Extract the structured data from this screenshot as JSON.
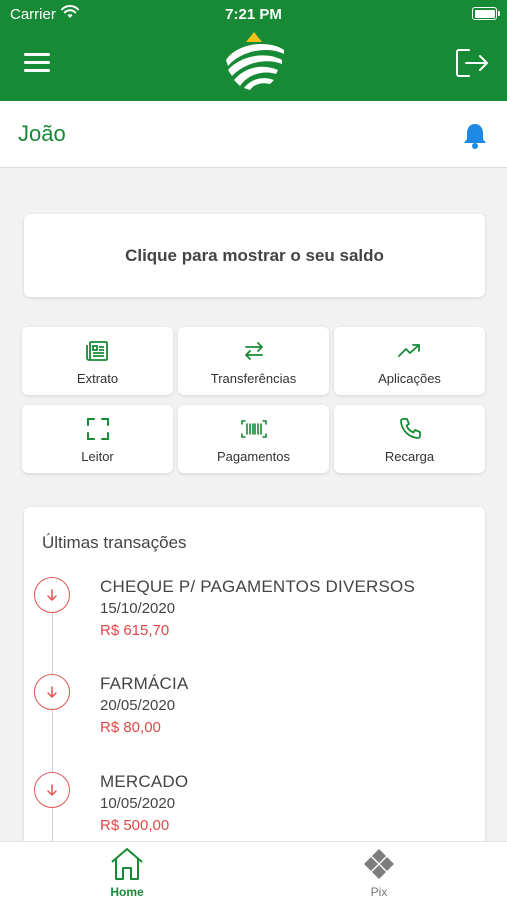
{
  "status_bar": {
    "carrier": "Carrier",
    "time": "7:21 PM"
  },
  "header": {
    "menu_icon": "hamburger-menu-icon",
    "logo": "bank-logo",
    "logout_icon": "logout-icon"
  },
  "user": {
    "name": "João",
    "notification_icon": "bell-icon"
  },
  "balance": {
    "label": "Clique para mostrar o seu saldo"
  },
  "actions": [
    {
      "label": "Extrato",
      "icon": "receipt-icon"
    },
    {
      "label": "Transferências",
      "icon": "transfer-arrows-icon"
    },
    {
      "label": "Aplicações",
      "icon": "trending-up-icon"
    },
    {
      "label": "Leitor",
      "icon": "scan-frame-icon"
    },
    {
      "label": "Pagamentos",
      "icon": "barcode-icon"
    },
    {
      "label": "Recarga",
      "icon": "phone-icon"
    }
  ],
  "transactions": {
    "title": "Últimas transações",
    "items": [
      {
        "name": "CHEQUE P/ PAGAMENTOS DIVERSOS",
        "date": "15/10/2020",
        "amount": "R$ 615,70"
      },
      {
        "name": "FARMÁCIA",
        "date": "20/05/2020",
        "amount": "R$ 80,00"
      },
      {
        "name": "MERCADO",
        "date": "10/05/2020",
        "amount": "R$ 500,00"
      }
    ]
  },
  "tabs": [
    {
      "label": "Home",
      "icon": "home-icon",
      "active": true
    },
    {
      "label": "Pix",
      "icon": "pix-icon",
      "active": false
    }
  ],
  "colors": {
    "brand_green": "#178a35",
    "accent_blue": "#1e88e5",
    "debit_red": "#e04848",
    "background": "#f2f2f2"
  }
}
